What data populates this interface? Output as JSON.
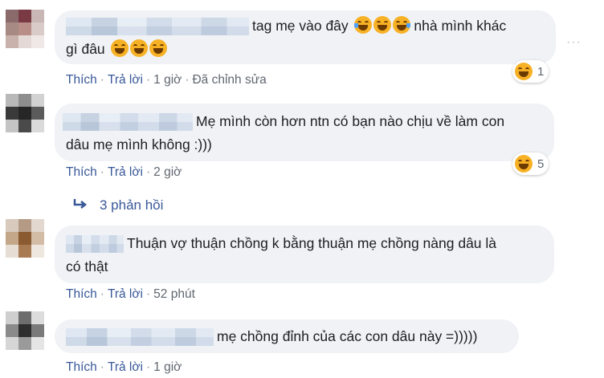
{
  "comments": [
    {
      "line1": "tag mẹ vào đây",
      "line1_after": "nhà mình khác",
      "line2": "gì đâu",
      "like": "Thích",
      "reply": "Trả lời",
      "time": "1 giờ",
      "edited": "Đã chỉnh sửa",
      "reaction_icon": "laughing-emoji-icon",
      "reaction_count": "1"
    },
    {
      "line1": "Mẹ mình còn hơn ntn có bạn nào chịu về làm con",
      "line2": "dâu mẹ mình không :)))",
      "like": "Thích",
      "reply": "Trả lời",
      "time": "2 giờ",
      "reaction_icon": "laughing-emoji-icon",
      "reaction_count": "5"
    },
    {
      "line1": "Thuận vợ thuận chồng k bằng thuận mẹ chồng nàng dâu là",
      "line2": "có thật",
      "like": "Thích",
      "reply": "Trả lời",
      "time": "52 phút"
    },
    {
      "line1": "mẹ chồng đỉnh của các con dâu này =)))))",
      "like": "Thích",
      "reply": "Trả lời",
      "time": "1 giờ"
    }
  ],
  "replies_link": "3 phản hồi",
  "more_options": "···",
  "separator": "·",
  "colors": {
    "bubble": "#f0f2f5",
    "link": "#385898",
    "meta": "#606770",
    "emoji": "#f7b125"
  }
}
